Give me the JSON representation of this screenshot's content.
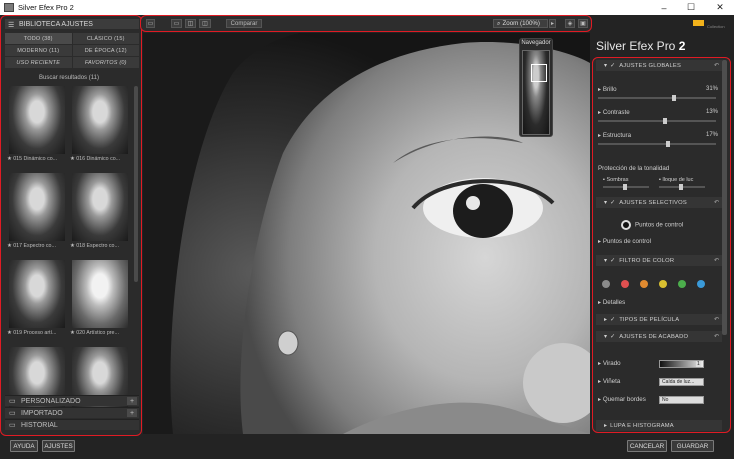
{
  "window": {
    "title": "Silver Efex Pro 2",
    "min": "–",
    "max": "☐",
    "close": "✕"
  },
  "library": {
    "header": "BIBLIOTECA AJUSTES",
    "tabs": [
      "TODO (38)",
      "CLÁSICO (15)",
      "MODERNO (11)",
      "DE ÉPOCA (12)",
      "USO RECIENTE",
      "FAVORITOS (0)"
    ],
    "results": "Buscar resultados (11)",
    "thumbs": [
      "★ 015 Dinámico co...",
      "★ 016 Dinámico co...",
      "★ 017 Espectro co...",
      "★ 018 Espectro co...",
      "★ 019 Proceso artí...",
      "★ 020 Artístico pre...",
      "",
      ""
    ],
    "sections": [
      {
        "label": "PERSONALIZADO",
        "plus": "+"
      },
      {
        "label": "IMPORTADO",
        "plus": "+"
      },
      {
        "label": "HISTORIAL",
        "plus": ""
      }
    ]
  },
  "toolbar": {
    "compare": "Comparar",
    "zoom": "Zoom (100%)"
  },
  "navigator": {
    "title": "Navegador"
  },
  "panel": {
    "brand_name": "Silver Efex Pro",
    "brand_num": "2",
    "logo_text": "Collection",
    "global": {
      "title": "AJUSTES GLOBALES",
      "brillo": "Brillo",
      "brillo_val": "31%",
      "contraste": "Contraste",
      "contraste_val": "13%",
      "estructura": "Estructura",
      "estructura_val": "17%",
      "tonal": "Protección de la tonalidad",
      "sombras": "Sombras",
      "luces": "lloque de luc"
    },
    "selective": {
      "title": "AJUSTES SELECTIVOS",
      "points_btn": "Puntos de control",
      "points_row": "Puntos de control"
    },
    "color": {
      "title": "FILTRO DE COLOR",
      "details": "Detalles",
      "dots": [
        "#8a8a8a",
        "#e05050",
        "#e08a30",
        "#d9c030",
        "#4cae4c",
        "#3a9ad9"
      ]
    },
    "film": {
      "title": "TIPOS DE PELÍCULA"
    },
    "finish": {
      "title": "AJUSTES DE ACABADO",
      "virado": "Virado",
      "virado_val": "1",
      "vineta": "Viñeta",
      "vineta_val": "Caída de luz...",
      "quemar": "Quemar bordes",
      "quemar_val": "No"
    },
    "loupe": {
      "title": "LUPA E HISTOGRAMA"
    }
  },
  "bottom": {
    "help": "AYUDA",
    "settings": "AJUSTES",
    "cancel": "CANCELAR",
    "save": "GUARDAR"
  }
}
